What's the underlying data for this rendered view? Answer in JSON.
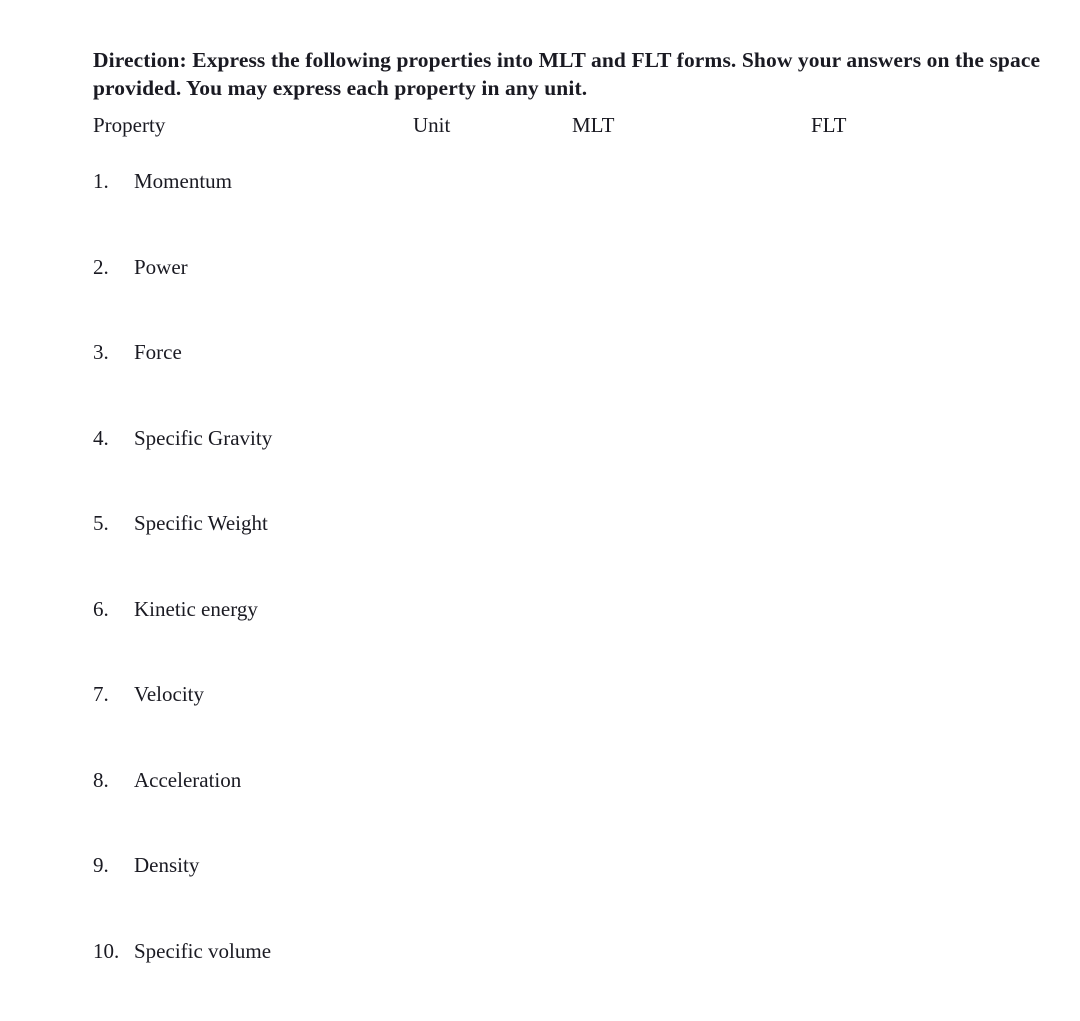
{
  "document": {
    "background_color": "#ffffff",
    "text_color": "#1a1a22"
  },
  "direction": {
    "text": "Direction: Express the following properties into MLT and FLT forms. Show your answers on the space provided. You may express each property in any unit."
  },
  "table": {
    "headers": {
      "property": "Property",
      "unit": "Unit",
      "mlt": "MLT",
      "flt": "FLT"
    },
    "rows": [
      {
        "number": "1.",
        "property": "Momentum",
        "unit": "",
        "mlt": "",
        "flt": ""
      },
      {
        "number": "2.",
        "property": "Power",
        "unit": "",
        "mlt": "",
        "flt": ""
      },
      {
        "number": "3.",
        "property": "Force",
        "unit": "",
        "mlt": "",
        "flt": ""
      },
      {
        "number": "4.",
        "property": "Specific Gravity",
        "unit": "",
        "mlt": "",
        "flt": ""
      },
      {
        "number": "5.",
        "property": "Specific Weight",
        "unit": "",
        "mlt": "",
        "flt": ""
      },
      {
        "number": "6.",
        "property": "Kinetic energy",
        "unit": "",
        "mlt": "",
        "flt": ""
      },
      {
        "number": "7.",
        "property": "Velocity",
        "unit": "",
        "mlt": "",
        "flt": ""
      },
      {
        "number": "8.",
        "property": "Acceleration",
        "unit": "",
        "mlt": "",
        "flt": ""
      },
      {
        "number": "9.",
        "property": "Density",
        "unit": "",
        "mlt": "",
        "flt": ""
      },
      {
        "number": "10.",
        "property": "Specific volume",
        "unit": "",
        "mlt": "",
        "flt": ""
      }
    ]
  }
}
